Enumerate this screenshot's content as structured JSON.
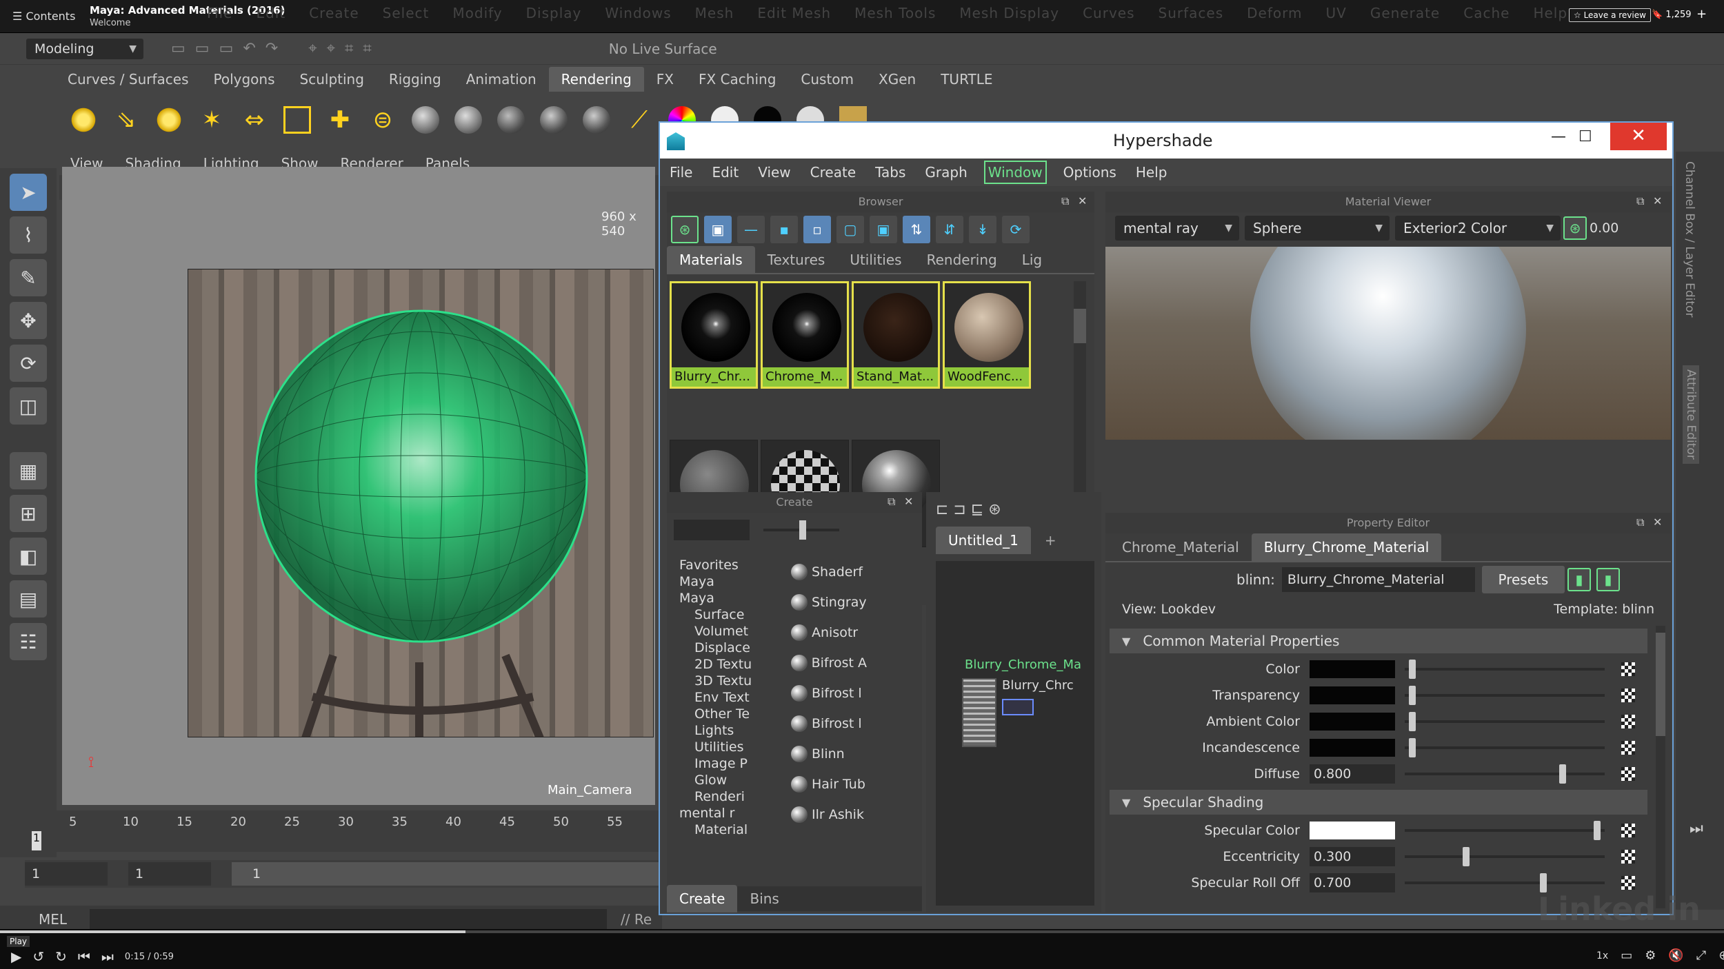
{
  "video": {
    "contents_label": "Contents",
    "course_title": "Maya: Advanced Materials (2016)",
    "chapter": "Welcome",
    "review_label": "☆ Leave a review",
    "bookmark_count": "1,259",
    "play_label": "Play",
    "time": "0:15 / 0:59",
    "speed": "1x",
    "progress": 0.27
  },
  "maya": {
    "main_menu": [
      "File",
      "Edit",
      "Create",
      "Select",
      "Modify",
      "Display",
      "Windows",
      "Mesh",
      "Edit Mesh",
      "Mesh Tools",
      "Mesh Display",
      "Curves",
      "Surfaces",
      "Deform",
      "UV",
      "Generate",
      "Cache",
      "Help"
    ],
    "mode": "Modeling",
    "live_surface": "No Live Surface",
    "shelf_tabs": [
      "Curves / Surfaces",
      "Polygons",
      "Sculpting",
      "Rigging",
      "Animation",
      "Rendering",
      "FX",
      "FX Caching",
      "Custom",
      "XGen",
      "TURTLE"
    ],
    "active_shelf": "Rendering",
    "viewport_menu": [
      "View",
      "Shading",
      "Lighting",
      "Show",
      "Renderer",
      "Panels"
    ],
    "resolution": "960 x 540",
    "camera": "Main_Camera",
    "timeline_ticks": [
      "5",
      "10",
      "15",
      "20",
      "25",
      "30",
      "35",
      "40",
      "45",
      "50",
      "55"
    ],
    "current_frame": "1",
    "range_start": "1",
    "range_start2": "1",
    "range_field": "1",
    "mel_label": "MEL",
    "cmd_text": "// Re",
    "side_tabs": [
      "Channel Box / Layer Editor",
      "Attribute Editor"
    ]
  },
  "hypershade": {
    "title": "Hypershade",
    "menu": [
      "File",
      "Edit",
      "View",
      "Create",
      "Tabs",
      "Graph",
      "Window",
      "Options",
      "Help"
    ],
    "highlighted_menu": "Window",
    "browser": {
      "title": "Browser",
      "tabs": [
        "Materials",
        "Textures",
        "Utilities",
        "Rendering",
        "Lig"
      ],
      "active_tab": "Materials",
      "swatches": [
        {
          "label": "Blurry_Chr...",
          "orb": "radial-gradient(circle at 50% 45%,#fff 0%,#777 6%,#111 30%,#000 70%)",
          "selected": true
        },
        {
          "label": "Chrome_M...",
          "orb": "radial-gradient(circle at 50% 45%,#fff 0%,#888 5%,#111 28%,#000 70%)",
          "selected": true
        },
        {
          "label": "Stand_Mat...",
          "orb": "radial-gradient(circle at 45% 40%,#3a2418,#1a0e08 70%)",
          "selected": true
        },
        {
          "label": "WoodFenc...",
          "orb": "radial-gradient(circle at 40% 35%,#d8c7b2,#8c7764 60%,#4a3c30)",
          "selected": true
        },
        {
          "label": "",
          "orb": "radial-gradient(circle at 40% 35%,#888,#444 70%)",
          "selected": false
        },
        {
          "label": "",
          "orb": "repeating-conic-gradient(#111 0 25%,#ccc 0 50%) 0 0/24px 24px",
          "selected": false
        },
        {
          "label": "",
          "orb": "radial-gradient(circle at 40% 30%,#fff 0%,#aaa 15%,#333 60%,#111)",
          "selected": false
        }
      ]
    },
    "material_viewer": {
      "title": "Material Viewer",
      "renderer": "mental ray",
      "shape": "Sphere",
      "environment": "Exterior2 Color",
      "exposure": "0.00"
    },
    "create": {
      "title": "Create",
      "tree": [
        "Favorites",
        "Maya",
        "Maya",
        "Surface",
        "Volumet",
        "Displace",
        "2D Textu",
        "3D Textu",
        "Env Text",
        "Other Te",
        "Lights",
        "Utilities",
        "Image P",
        "Glow",
        "Renderi",
        "mental r",
        "Material"
      ],
      "list": [
        "Shaderf",
        "Stingray",
        "Anisotr",
        "Bifrost A",
        "Bifrost l",
        "Bifrost l",
        "Blinn",
        "Hair Tub",
        "Ilr Ashik"
      ],
      "bottom_tabs": [
        "Create",
        "Bins"
      ]
    },
    "graph": {
      "tab": "Untitled_1",
      "add_tab": "+",
      "node_label": "Blurry_Chrome_Ma",
      "node_sub": "Blurry_Chrc"
    },
    "property_editor": {
      "title": "Property Editor",
      "tabs": [
        "Chrome_Material",
        "Blurry_Chrome_Material"
      ],
      "active_tab": "Blurry_Chrome_Material",
      "type_label": "blinn:",
      "name": "Blurry_Chrome_Material",
      "presets": "Presets",
      "view": "View: Lookdev",
      "template": "Template: blinn",
      "sections": [
        {
          "name": "Common Material Properties",
          "attrs": [
            {
              "label": "Color",
              "kind": "color",
              "color": "#050505",
              "slider": 0.02
            },
            {
              "label": "Transparency",
              "kind": "color",
              "color": "#050505",
              "slider": 0.02
            },
            {
              "label": "Ambient Color",
              "kind": "color",
              "color": "#050505",
              "slider": 0.02
            },
            {
              "label": "Incandescence",
              "kind": "color",
              "color": "#050505",
              "slider": 0.02
            },
            {
              "label": "Diffuse",
              "kind": "num",
              "value": "0.800",
              "slider": 0.8
            }
          ]
        },
        {
          "name": "Specular Shading",
          "attrs": [
            {
              "label": "Specular Color",
              "kind": "color",
              "color": "#ffffff",
              "slider": 0.98
            },
            {
              "label": "Eccentricity",
              "kind": "num",
              "value": "0.300",
              "slider": 0.3
            },
            {
              "label": "Specular Roll Off",
              "kind": "num",
              "value": "0.700",
              "slider": 0.7
            }
          ]
        }
      ]
    }
  },
  "watermark": "Linked in"
}
